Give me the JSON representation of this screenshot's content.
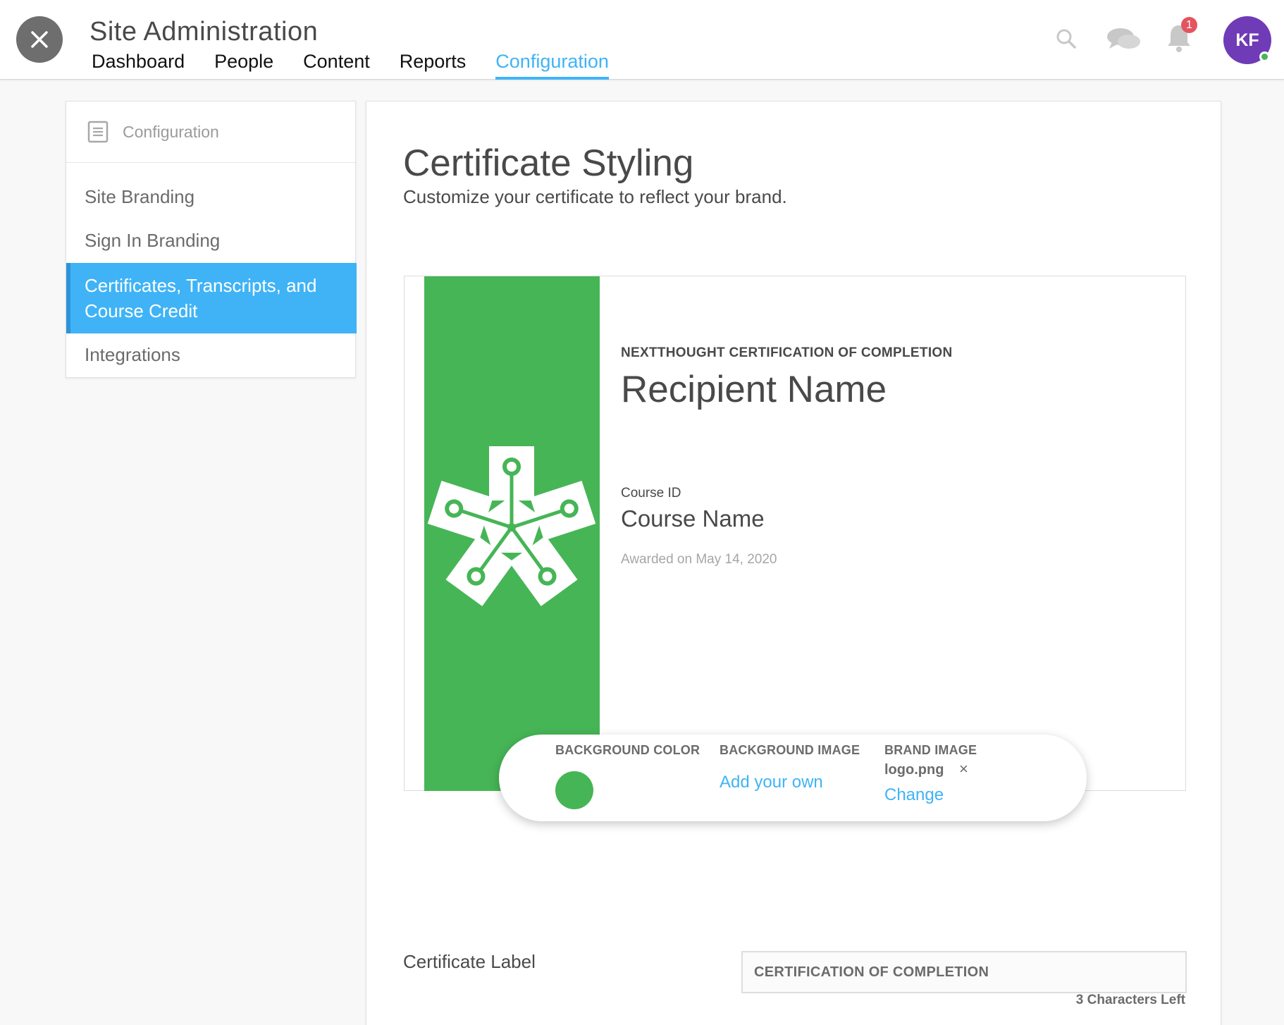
{
  "header": {
    "title": "Site Administration",
    "tabs": [
      {
        "label": "Dashboard"
      },
      {
        "label": "People"
      },
      {
        "label": "Content"
      },
      {
        "label": "Reports"
      },
      {
        "label": "Configuration",
        "active": true
      }
    ],
    "notification_count": "1",
    "avatar_initials": "KF",
    "icons": [
      "close-icon",
      "search-icon",
      "chat-icon",
      "bell-icon"
    ]
  },
  "sidebar": {
    "heading": "Configuration",
    "items": [
      {
        "label": "Site Branding"
      },
      {
        "label": "Sign In Branding"
      },
      {
        "label": "Certificates, Transcripts, and Course Credit",
        "active": true
      },
      {
        "label": "Integrations"
      }
    ]
  },
  "main": {
    "title": "Certificate Styling",
    "subtitle": "Customize your certificate to reflect your brand.",
    "certificate": {
      "preheader": "NEXTTHOUGHT CERTIFICATION OF COMPLETION",
      "recipient": "Recipient Name",
      "course_id_label": "Course ID",
      "course_name": "Course Name",
      "awarded": "Awarded on May 14, 2020",
      "band_color": "#46b556"
    },
    "controls": {
      "background_color_label": "BACKGROUND COLOR",
      "background_color": "#46b556",
      "background_image_label": "BACKGROUND IMAGE",
      "background_image_link": "Add your own",
      "brand_image_label": "BRAND IMAGE",
      "brand_image_file": "logo.png",
      "brand_image_remove": "×",
      "brand_image_link": "Change"
    },
    "label_field": {
      "label": "Certificate Label",
      "value": "CERTIFICATION OF COMPLETION",
      "counter": "3 Characters Left"
    }
  },
  "colors": {
    "accent": "#3fb3f6",
    "brand_green": "#46b556",
    "avatar": "#6f3bb6",
    "badge": "#e4545e"
  }
}
